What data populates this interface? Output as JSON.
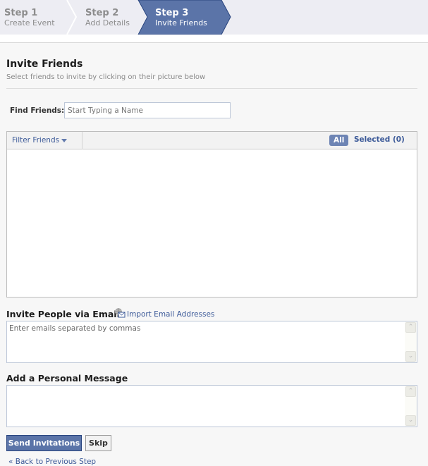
{
  "steps": [
    {
      "number": "Step 1",
      "label": "Create Event",
      "active": false
    },
    {
      "number": "Step 2",
      "label": "Add Details",
      "active": false
    },
    {
      "number": "Step 3",
      "label": "Invite Friends",
      "active": true
    }
  ],
  "invite": {
    "title": "Invite Friends",
    "subtitle": "Select friends to invite by clicking on their picture below",
    "find_label": "Find Friends:",
    "find_placeholder": "Start Typing a Name"
  },
  "friends_box": {
    "filter_label": "Filter Friends",
    "all_label": "All",
    "selected_label": "Selected (0)"
  },
  "email": {
    "title": "Invite People via Email",
    "import_label": "Import Email Addresses",
    "placeholder": "Enter emails separated by commas"
  },
  "message": {
    "title": "Add a Personal Message",
    "value": ""
  },
  "actions": {
    "send_label": "Send Invitations",
    "skip_label": "Skip",
    "back_label": "« Back to Previous Step"
  },
  "colors": {
    "accent": "#3b5998",
    "active_step": "#5b74a8",
    "pill": "#6d84b4"
  }
}
